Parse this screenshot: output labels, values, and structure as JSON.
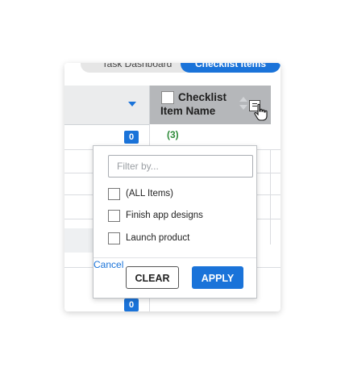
{
  "tabs": {
    "task_dashboard": "Task Dashboard",
    "checklist_items": "Checklist Items"
  },
  "column_header": {
    "line1": "Checklist",
    "line2": "Item Name"
  },
  "group_count": "(3)",
  "badges": [
    "0",
    "0"
  ],
  "filter_popup": {
    "placeholder": "Filter by...",
    "options": [
      {
        "label": "(ALL Items)",
        "checked": false
      },
      {
        "label": "Finish app designs",
        "checked": false
      },
      {
        "label": "Launch product",
        "checked": false
      }
    ],
    "cancel_label": "Cancel",
    "clear_label": "CLEAR",
    "apply_label": "APPLY"
  },
  "colors": {
    "accent": "#1a73d9",
    "header_active": "#b5b7ba",
    "count_green": "#2e8b3a"
  },
  "icons": [
    "caret-down-icon",
    "sort-icon",
    "filter-icon",
    "hand-cursor-icon"
  ]
}
